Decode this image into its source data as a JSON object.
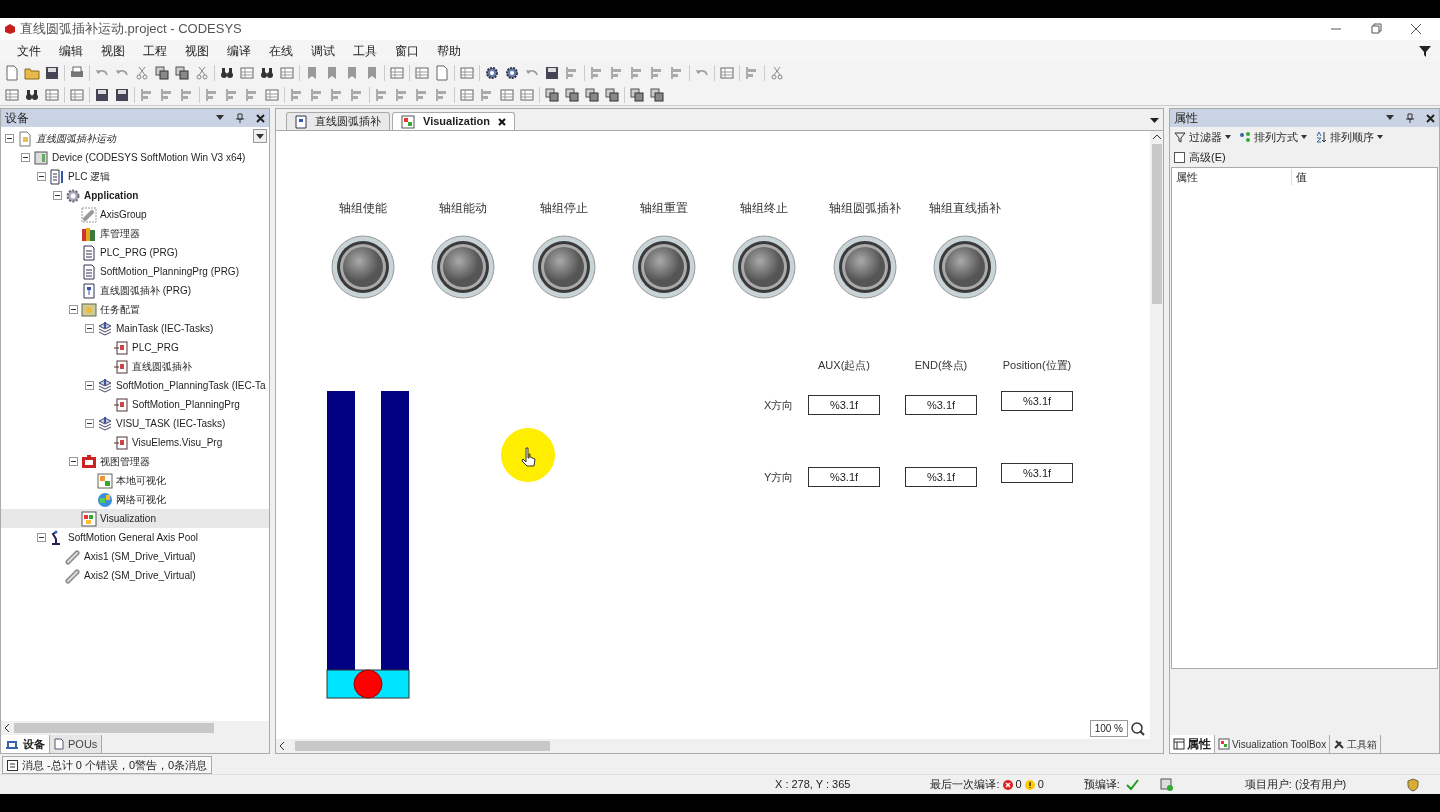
{
  "window": {
    "title": "直线圆弧插补运动.project - CODESYS"
  },
  "menu": [
    "文件",
    "编辑",
    "视图",
    "工程",
    "视图",
    "编译",
    "在线",
    "调试",
    "工具",
    "窗口",
    "帮助"
  ],
  "devices_panel": {
    "title": "设备",
    "tree": [
      {
        "label": "直线圆弧插补运动",
        "kind": "project",
        "expanded": true,
        "selected": false,
        "children": [
          {
            "label": "Device (CODESYS SoftMotion Win V3 x64)",
            "kind": "device",
            "expanded": true,
            "selected": false,
            "children": [
              {
                "label": "PLC 逻辑",
                "kind": "plc",
                "expanded": true,
                "selected": false,
                "children": [
                  {
                    "label": "Application",
                    "kind": "application",
                    "expanded": true,
                    "selected": false,
                    "children": [
                      {
                        "label": "AxisGroup",
                        "kind": "axisgroup",
                        "selected": false
                      },
                      {
                        "label": "库管理器",
                        "kind": "library",
                        "selected": false
                      },
                      {
                        "label": "PLC_PRG (PRG)",
                        "kind": "pou",
                        "selected": false
                      },
                      {
                        "label": "SoftMotion_PlanningPrg (PRG)",
                        "kind": "pou",
                        "selected": false
                      },
                      {
                        "label": "直线圆弧插补 (PRG)",
                        "kind": "sfc",
                        "selected": false
                      },
                      {
                        "label": "任务配置",
                        "kind": "taskconfig",
                        "expanded": true,
                        "selected": false,
                        "children": [
                          {
                            "label": "MainTask (IEC-Tasks)",
                            "kind": "task",
                            "expanded": true,
                            "selected": false,
                            "children": [
                              {
                                "label": "PLC_PRG",
                                "kind": "call",
                                "selected": false
                              },
                              {
                                "label": "直线圆弧插补",
                                "kind": "call",
                                "selected": false
                              }
                            ]
                          },
                          {
                            "label": "SoftMotion_PlanningTask (IEC-Ta",
                            "kind": "task",
                            "expanded": true,
                            "selected": false,
                            "children": [
                              {
                                "label": "SoftMotion_PlanningPrg",
                                "kind": "call",
                                "selected": false
                              }
                            ]
                          },
                          {
                            "label": "VISU_TASK (IEC-Tasks)",
                            "kind": "task",
                            "expanded": true,
                            "selected": false,
                            "children": [
                              {
                                "label": "VisuElems.Visu_Prg",
                                "kind": "call",
                                "selected": false
                              }
                            ]
                          }
                        ]
                      },
                      {
                        "label": "视图管理器",
                        "kind": "visumanager",
                        "expanded": true,
                        "selected": false,
                        "children": [
                          {
                            "label": "本地可视化",
                            "kind": "targetvisu",
                            "selected": false
                          },
                          {
                            "label": "网络可视化",
                            "kind": "webvisu",
                            "selected": false
                          }
                        ]
                      },
                      {
                        "label": "Visualization",
                        "kind": "visu",
                        "selected": true
                      }
                    ]
                  }
                ]
              },
              {
                "label": "SoftMotion General Axis Pool",
                "kind": "axispool",
                "expanded": true,
                "selected": false,
                "children": [
                  {
                    "label": "Axis1 (SM_Drive_Virtual)",
                    "kind": "axis",
                    "selected": false
                  },
                  {
                    "label": "Axis2 (SM_Drive_Virtual)",
                    "kind": "axis",
                    "selected": false
                  }
                ]
              }
            ]
          }
        ]
      }
    ],
    "tabs": [
      {
        "label": "设备",
        "selected": true
      },
      {
        "label": "POUs",
        "selected": false
      }
    ]
  },
  "editor": {
    "tabs": [
      {
        "label": "直线圆弧插补",
        "selected": false
      },
      {
        "label": "Visualization",
        "selected": true
      }
    ],
    "buttons": [
      "轴组使能",
      "轴组能动",
      "轴组停止",
      "轴组重置",
      "轴组终止",
      "轴组圆弧插补",
      "轴组直线插补"
    ],
    "table": {
      "columns": [
        "AUX(起点)",
        "END(终点)",
        "Position(位置)"
      ],
      "rows": [
        {
          "label": "X方向",
          "cells": [
            "%3.1f",
            "%3.1f",
            "%3.1f"
          ]
        },
        {
          "label": "Y方向",
          "cells": [
            "%3.1f",
            "%3.1f",
            "%3.1f"
          ]
        }
      ]
    },
    "zoom": "100 %"
  },
  "properties_panel": {
    "title": "属性",
    "toolbar": [
      "过滤器",
      "排列方式",
      "排列顺序"
    ],
    "advanced": {
      "label": "高级(E)",
      "checked": false
    },
    "columns": [
      "属性",
      "值"
    ],
    "tabs": [
      {
        "label": "属性",
        "selected": true
      },
      {
        "label": "Visualization ToolBox",
        "selected": false
      },
      {
        "label": "工具箱",
        "selected": false
      }
    ]
  },
  "messages_tab": "消息 -总计 0 个错误，0警告，0条消息",
  "status_bar": {
    "position": "X : 278, Y : 365",
    "last_build": "最后一次编译:",
    "errors": "0",
    "warnings": "0",
    "precompile": "预编译:",
    "user": "项目用户: (没有用户)"
  }
}
